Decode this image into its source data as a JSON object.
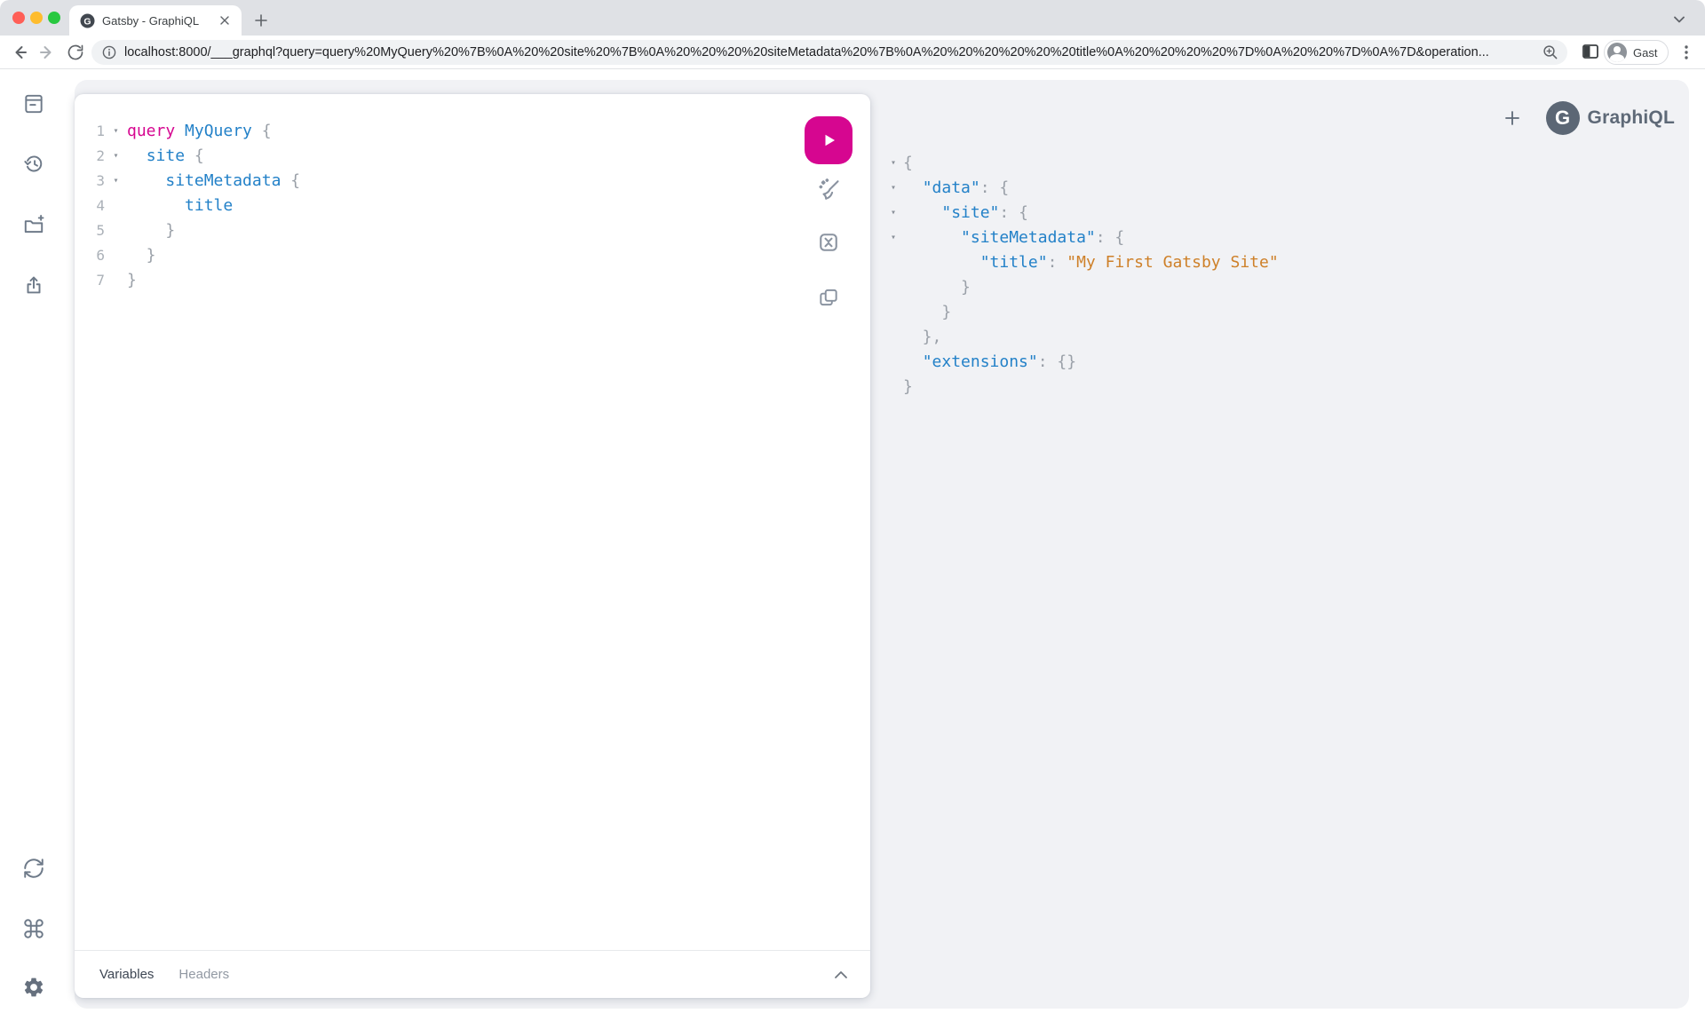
{
  "browser": {
    "tab_title": "Gatsby - GraphiQL",
    "url": "localhost:8000/___graphql?query=query%20MyQuery%20%7B%0A%20%20site%20%7B%0A%20%20%20%20siteMetadata%20%7B%0A%20%20%20%20%20%20title%0A%20%20%20%20%7D%0A%20%20%7D%0A%7D&operation...",
    "profile_name": "Gast",
    "favicon_letter": "G"
  },
  "graphiql": {
    "logo_text": "GraphiQL",
    "logo_letter": "G",
    "colors": {
      "primary": "#D60690",
      "property_blue": "#2381C8",
      "string_orange": "#CE8029",
      "punctuation_gray": "#9AA0A8",
      "icon_slate": "#6E7A89",
      "sessions_bg": "#F1F2F5"
    },
    "editor": {
      "lines": [
        {
          "num": "1",
          "fold": true,
          "tokens": [
            {
              "t": "query",
              "c": "kw"
            },
            {
              "t": " ",
              "c": "pl"
            },
            {
              "t": "MyQuery",
              "c": "prop"
            },
            {
              "t": " ",
              "c": "pl"
            },
            {
              "t": "{",
              "c": "pn"
            }
          ]
        },
        {
          "num": "2",
          "fold": true,
          "tokens": [
            {
              "t": "  ",
              "c": "pl"
            },
            {
              "t": "site",
              "c": "prop"
            },
            {
              "t": " ",
              "c": "pl"
            },
            {
              "t": "{",
              "c": "pn"
            }
          ]
        },
        {
          "num": "3",
          "fold": true,
          "tokens": [
            {
              "t": "    ",
              "c": "pl"
            },
            {
              "t": "siteMetadata",
              "c": "prop"
            },
            {
              "t": " ",
              "c": "pl"
            },
            {
              "t": "{",
              "c": "pn"
            }
          ]
        },
        {
          "num": "4",
          "fold": false,
          "tokens": [
            {
              "t": "      ",
              "c": "pl"
            },
            {
              "t": "title",
              "c": "prop"
            }
          ]
        },
        {
          "num": "5",
          "fold": false,
          "tokens": [
            {
              "t": "    }",
              "c": "pn"
            }
          ]
        },
        {
          "num": "6",
          "fold": false,
          "tokens": [
            {
              "t": "  }",
              "c": "pn"
            }
          ]
        },
        {
          "num": "7",
          "fold": false,
          "tokens": [
            {
              "t": "}",
              "c": "pn"
            }
          ]
        }
      ],
      "footer_tabs": [
        {
          "label": "Variables",
          "active": true
        },
        {
          "label": "Headers",
          "active": false
        }
      ]
    },
    "response": {
      "lines": [
        {
          "fold": true,
          "tokens": [
            {
              "t": "{",
              "c": "pn"
            }
          ]
        },
        {
          "fold": true,
          "tokens": [
            {
              "t": "  ",
              "c": "pl"
            },
            {
              "t": "\"data\"",
              "c": "key"
            },
            {
              "t": ": {",
              "c": "pn"
            }
          ]
        },
        {
          "fold": true,
          "tokens": [
            {
              "t": "    ",
              "c": "pl"
            },
            {
              "t": "\"site\"",
              "c": "key"
            },
            {
              "t": ": {",
              "c": "pn"
            }
          ]
        },
        {
          "fold": true,
          "tokens": [
            {
              "t": "      ",
              "c": "pl"
            },
            {
              "t": "\"siteMetadata\"",
              "c": "key"
            },
            {
              "t": ": {",
              "c": "pn"
            }
          ]
        },
        {
          "fold": false,
          "tokens": [
            {
              "t": "        ",
              "c": "pl"
            },
            {
              "t": "\"title\"",
              "c": "key"
            },
            {
              "t": ": ",
              "c": "pn"
            },
            {
              "t": "\"My First Gatsby Site\"",
              "c": "str"
            }
          ]
        },
        {
          "fold": false,
          "tokens": [
            {
              "t": "      }",
              "c": "pn"
            }
          ]
        },
        {
          "fold": false,
          "tokens": [
            {
              "t": "    }",
              "c": "pn"
            }
          ]
        },
        {
          "fold": false,
          "tokens": [
            {
              "t": "  },",
              "c": "pn"
            }
          ]
        },
        {
          "fold": false,
          "tokens": [
            {
              "t": "  ",
              "c": "pl"
            },
            {
              "t": "\"extensions\"",
              "c": "key"
            },
            {
              "t": ": {}",
              "c": "pn"
            }
          ]
        },
        {
          "fold": false,
          "tokens": [
            {
              "t": "}",
              "c": "pn"
            }
          ]
        }
      ]
    }
  }
}
